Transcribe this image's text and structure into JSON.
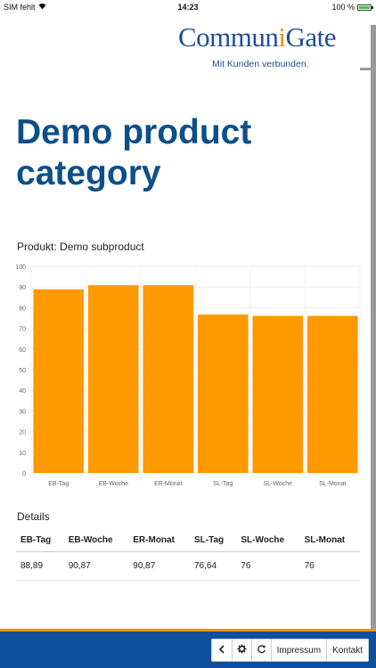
{
  "status_bar": {
    "carrier": "SIM fehlt",
    "time": "14:23",
    "battery": "100 %",
    "battery_level": 1.0
  },
  "logo": {
    "text_before": "Commun",
    "text_accent": "i",
    "text_after": "Gate",
    "tagline": "Mit Kunden verbunden."
  },
  "page": {
    "title": "Demo product category"
  },
  "chart_data": {
    "type": "bar",
    "title": "Produkt: Demo subproduct",
    "categories": [
      "EB-Tag",
      "EB-Woche",
      "ER-Monat",
      "SL-Tag",
      "SL-Woche",
      "SL-Monat"
    ],
    "values": [
      88.89,
      90.87,
      90.87,
      76.64,
      76,
      76
    ],
    "ylim": [
      0,
      100
    ],
    "yticks": [
      0,
      10,
      20,
      30,
      40,
      50,
      60,
      70,
      80,
      90,
      100
    ],
    "grid": true,
    "bar_color": "#ff9900"
  },
  "details": {
    "title": "Details",
    "headers": [
      "EB-Tag",
      "EB-Woche",
      "ER-Monat",
      "SL-Tag",
      "SL-Woche",
      "SL-Monat"
    ],
    "rows": [
      [
        "88,89",
        "90,87",
        "90,87",
        "76,64",
        "76",
        "76"
      ]
    ]
  },
  "footer": {
    "buttons": {
      "back_icon": "chevron-left-icon",
      "settings_icon": "gear-icon",
      "refresh_icon": "refresh-icon",
      "impressum": "Impressum",
      "kontakt": "Kontakt"
    },
    "accent_color": "#f39200",
    "bar_color": "#0d4f9b"
  }
}
